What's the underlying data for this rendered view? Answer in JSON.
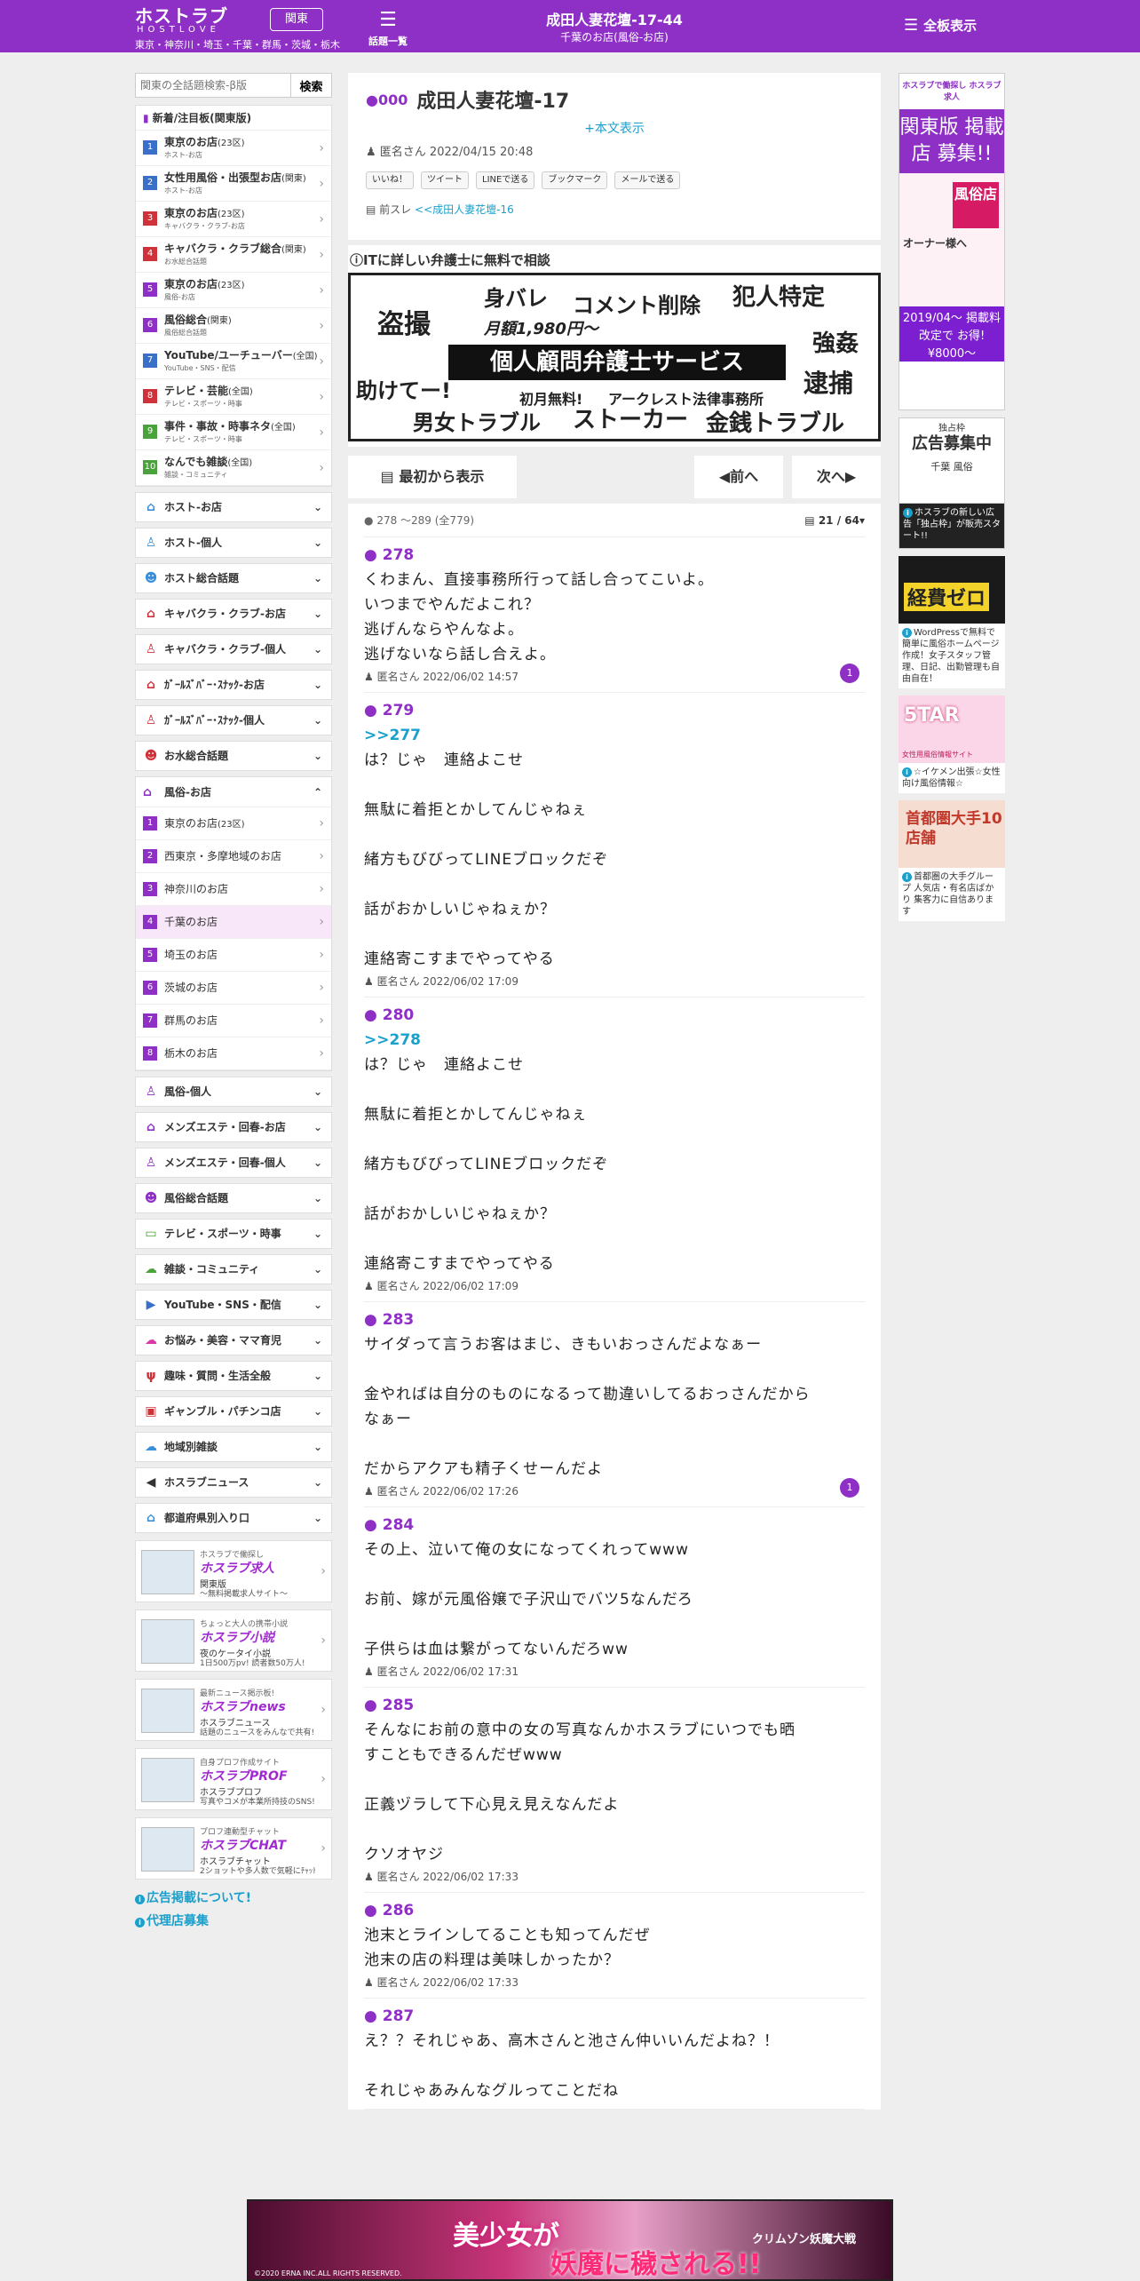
{
  "header": {
    "logo_jp": "ホストラブ",
    "logo_en": "HOSTLOVE",
    "area": "関東",
    "area_sub": "東京・神奈川・埼玉・千葉・群馬・茨城・栃木",
    "topic_list_label": "話題一覧",
    "title": "成田人妻花壇-17-44",
    "subtitle": "千葉のお店(風俗-お店)",
    "all_boards": "全板表示"
  },
  "search": {
    "placeholder": "関東の全話題検索-β版",
    "button": "検索"
  },
  "new_boards": {
    "title": "新着/注目板(関東版)",
    "items": [
      {
        "no": "1",
        "color": "#3a6fc9",
        "label": "東京のお店",
        "tag": "(23区)",
        "sub": "ホスト-お店"
      },
      {
        "no": "2",
        "color": "#3a6fc9",
        "label": "女性用風俗・出張型お店",
        "tag": "(関東)",
        "sub": "ホスト-お店"
      },
      {
        "no": "3",
        "color": "#d0323a",
        "label": "東京のお店",
        "tag": "(23区)",
        "sub": "キャバクラ・クラブ-お店"
      },
      {
        "no": "4",
        "color": "#d0323a",
        "label": "キャバクラ・クラブ総合",
        "tag": "(関東)",
        "sub": "お水総合話題"
      },
      {
        "no": "5",
        "color": "#8e2fc6",
        "label": "東京のお店",
        "tag": "(23区)",
        "sub": "風俗-お店"
      },
      {
        "no": "6",
        "color": "#8e2fc6",
        "label": "風俗総合",
        "tag": "(関東)",
        "sub": "風俗総合話題"
      },
      {
        "no": "7",
        "color": "#3a6fc9",
        "label": "YouTube/ユーチューバー",
        "tag": "(全国)",
        "sub": "YouTube・SNS・配信"
      },
      {
        "no": "8",
        "color": "#d0323a",
        "label": "テレビ・芸能",
        "tag": "(全国)",
        "sub": "テレビ・スポーツ・時事"
      },
      {
        "no": "9",
        "color": "#4aa33a",
        "label": "事件・事故・時事ネタ",
        "tag": "(全国)",
        "sub": "テレビ・スポーツ・時事"
      },
      {
        "no": "10",
        "color": "#4aa33a",
        "label": "なんでも雑談",
        "tag": "(全国)",
        "sub": "雑談・コミュニティ"
      }
    ]
  },
  "categories_a": [
    {
      "icon": "⌂",
      "color": "#3a8fd9",
      "label": "ホスト-お店"
    },
    {
      "icon": "♙",
      "color": "#3a8fd9",
      "label": "ホスト-個人"
    },
    {
      "icon": "☻",
      "color": "#3a8fd9",
      "label": "ホスト総合話題"
    },
    {
      "icon": "⌂",
      "color": "#d0323a",
      "label": "キャバクラ・クラブ-お店"
    },
    {
      "icon": "♙",
      "color": "#d0323a",
      "label": "キャバクラ・クラブ-個人"
    },
    {
      "icon": "⌂",
      "color": "#d0323a",
      "label": "ｶﾞｰﾙｽﾞﾊﾞｰ･ｽﾅｯｸ-お店"
    },
    {
      "icon": "♙",
      "color": "#d0323a",
      "label": "ｶﾞｰﾙｽﾞﾊﾞｰ･ｽﾅｯｸ-個人"
    },
    {
      "icon": "☻",
      "color": "#d0323a",
      "label": "お水総合話題"
    }
  ],
  "fuzoku_shop": {
    "label": "風俗-お店",
    "items": [
      {
        "no": "1",
        "label": "東京のお店",
        "tag": "(23区)"
      },
      {
        "no": "2",
        "label": "西東京・多摩地域のお店",
        "tag": ""
      },
      {
        "no": "3",
        "label": "神奈川のお店",
        "tag": ""
      },
      {
        "no": "4",
        "label": "千葉のお店",
        "tag": ""
      },
      {
        "no": "5",
        "label": "埼玉のお店",
        "tag": ""
      },
      {
        "no": "6",
        "label": "茨城のお店",
        "tag": ""
      },
      {
        "no": "7",
        "label": "群馬のお店",
        "tag": ""
      },
      {
        "no": "8",
        "label": "栃木のお店",
        "tag": ""
      }
    ]
  },
  "categories_b": [
    {
      "icon": "♙",
      "color": "#8e2fc6",
      "label": "風俗-個人"
    },
    {
      "icon": "⌂",
      "color": "#8e2fc6",
      "label": "メンズエステ・回春-お店"
    },
    {
      "icon": "♙",
      "color": "#8e2fc6",
      "label": "メンズエステ・回春-個人"
    },
    {
      "icon": "☻",
      "color": "#8e2fc6",
      "label": "風俗総合話題"
    },
    {
      "icon": "▭",
      "color": "#4aa33a",
      "label": "テレビ・スポーツ・時事"
    },
    {
      "icon": "☁",
      "color": "#4aa33a",
      "label": "雑談・コミュニティ"
    },
    {
      "icon": "▶",
      "color": "#3a6fc9",
      "label": "YouTube・SNS・配信"
    },
    {
      "icon": "☁",
      "color": "#d63aa8",
      "label": "お悩み・美容・ママ育児"
    },
    {
      "icon": "ψ",
      "color": "#d0323a",
      "label": "趣味・質問・生活全般"
    },
    {
      "icon": "▣",
      "color": "#d0323a",
      "label": "ギャンブル・パチンコ店"
    },
    {
      "icon": "☁",
      "color": "#3a8fd9",
      "label": "地域別雑談"
    },
    {
      "icon": "◀",
      "color": "#333333",
      "label": "ホスラブニュース"
    },
    {
      "icon": "⌂",
      "color": "#3a8fd9",
      "label": "都道府県別入り口"
    }
  ],
  "side_banners": [
    {
      "l1": "ホスラブで働探し",
      "l2": "ホスラブ求人",
      "l3": "関東版",
      "l4": "〜無料掲載求人サイト〜"
    },
    {
      "l1": "ちょっと大人の携帯小説",
      "l2": "ホスラブ小説",
      "l3": "夜のケータイ小説",
      "l4": "1日500万pv! 読者数50万人!"
    },
    {
      "l1": "最新ニュース掲示板!",
      "l2": "ホスラブnews",
      "l3": "ホスラブニュース",
      "l4": "話題のニュースをみんなで共有!"
    },
    {
      "l1": "自身プロフ作成サイト",
      "l2": "ホスラブPROF",
      "l3": "ホスラブプロフ",
      "l4": "写真やコメが本業所持技のSNS!"
    },
    {
      "l1": "プロフ連動型チャット",
      "l2": "ホスラブCHAT",
      "l3": "ホスラブチャット",
      "l4": "2ショットや多人数で気軽にﾁｬｯﾄ!"
    }
  ],
  "side_links": [
    "広告掲載について!",
    "代理店募集"
  ],
  "thread": {
    "no": "000",
    "title": "成田人妻花壇-17",
    "show_body": "+本文表示",
    "meta": "匿名さん 2022/04/15 20:48",
    "share": [
      "いいね！",
      "ツイート",
      "LINEで送る",
      "ブックマーク",
      "メールで送る"
    ],
    "prev_label": "前スレ",
    "prev_link": "<<成田人妻花壇-16"
  },
  "ad": {
    "head": "ITに詳しい弁護士に無料で相談",
    "words": [
      "盗撮",
      "身バレ",
      "コメント削除",
      "犯人特定",
      "強姦",
      "逮捕",
      "月額1,980円〜",
      "個人顧問弁護士サービス",
      "初月無料!",
      "アークレスト法律事務所",
      "助けてー!",
      "男女トラブル",
      "ストーカー",
      "金銭トラブル"
    ]
  },
  "nav": {
    "first": "最初から表示",
    "prev": "前へ",
    "next": "次へ"
  },
  "posts_head": {
    "range": "278 〜289 (全779)",
    "page": "21 / 64"
  },
  "posts": [
    {
      "no": "278",
      "reply": "",
      "lines": [
        "くわまん、直接事務所行って話し合ってこいよ。",
        "いつまでやんだよこれ？",
        "逃げんならやんなよ。",
        "逃げないなら話し合えよ。"
      ],
      "meta": "匿名さん 2022/06/02 14:57",
      "badge": "1"
    },
    {
      "no": "279",
      "reply": ">>277",
      "lines": [
        "は？じゃ　連絡よこせ",
        "",
        "無駄に着拒とかしてんじゃねぇ",
        "",
        "緒方もびびってLINEブロックだぞ",
        "",
        "話がおかしいじゃねぇか？",
        "",
        "連絡寄こすまでやってやる"
      ],
      "meta": "匿名さん 2022/06/02 17:09",
      "badge": ""
    },
    {
      "no": "280",
      "reply": ">>278",
      "lines": [
        "は？じゃ　連絡よこせ",
        "",
        "無駄に着拒とかしてんじゃねぇ",
        "",
        "緒方もびびってLINEブロックだぞ",
        "",
        "話がおかしいじゃねぇか？",
        "",
        "連絡寄こすまでやってやる"
      ],
      "meta": "匿名さん 2022/06/02 17:09",
      "badge": ""
    },
    {
      "no": "283",
      "reply": "",
      "lines": [
        "サイダって言うお客はまじ、きもいおっさんだよなぁー",
        "",
        "金やればは自分のものになるって勘違いしてるおっさんだから",
        "なぁー",
        "",
        "だからアクアも精子くせーんだよ"
      ],
      "meta": "匿名さん 2022/06/02 17:26",
      "badge": "1"
    },
    {
      "no": "284",
      "reply": "",
      "lines": [
        "その上、泣いて俺の女になってくれってwww",
        "",
        "お前、嫁が元風俗嬢で子沢山でバツ5なんだろ",
        "",
        "子供らは血は繋がってないんだろww"
      ],
      "meta": "匿名さん 2022/06/02 17:31",
      "badge": ""
    },
    {
      "no": "285",
      "reply": "",
      "lines": [
        "そんなにお前の意中の女の写真なんかホスラブにいつでも晒",
        "すこともできるんだぜwww",
        "",
        "正義ヅラして下心見え見えなんだよ",
        "",
        "クソオヤジ"
      ],
      "meta": "匿名さん 2022/06/02 17:33",
      "badge": ""
    },
    {
      "no": "286",
      "reply": "",
      "lines": [
        "池末とラインしてることも知ってんだぜ",
        "池末の店の料理は美味しかったか？"
      ],
      "meta": "匿名さん 2022/06/02 17:33",
      "badge": ""
    },
    {
      "no": "287",
      "reply": "",
      "lines": [
        "え？？それじゃあ、高木さんと池さん仲いいんだよね？！",
        "",
        "それじゃあみんなグルってことだね"
      ],
      "meta": "",
      "badge": ""
    }
  ],
  "right_ads": {
    "ad1": {
      "top": "ホスラブで働探し ホスラブ求人",
      "big": "関東版 掲載店 募集!!",
      "badge": "風俗店",
      "sub": "オーナー様へ",
      "foot": "2019/04〜 掲載料改定で お得!¥8000〜"
    },
    "ad2": {
      "head": "独占枠",
      "main": "広告募集中",
      "sub": "千葉 風俗",
      "cap": "ホスラブの新しい広告「独占枠」が販売スタート!!"
    },
    "ad3": {
      "main": "経費ゼロ",
      "cap": "WordPressで無料で簡単に風俗ホームページ作成！女子スタッフ管理、日記、出勤管理も自由自在！"
    },
    "ad4": {
      "main": "5TAR",
      "sub": "女性用風俗情報サイト",
      "cap": "☆イケメン出張☆女性向け風俗情報☆"
    },
    "ad5": {
      "main": "首都圏大手10店舗",
      "cap": "首都圏の大手グループ 人気店・有名店ばかり 集客力に自信あります"
    }
  },
  "bottom_ad": {
    "t1": "美少女が",
    "t2": "妖魔に穢される!!",
    "copyright": "©2020 ERNA INC.ALL RIGHTS RESERVED.",
    "logo": "クリムゾン妖魔大戦"
  }
}
